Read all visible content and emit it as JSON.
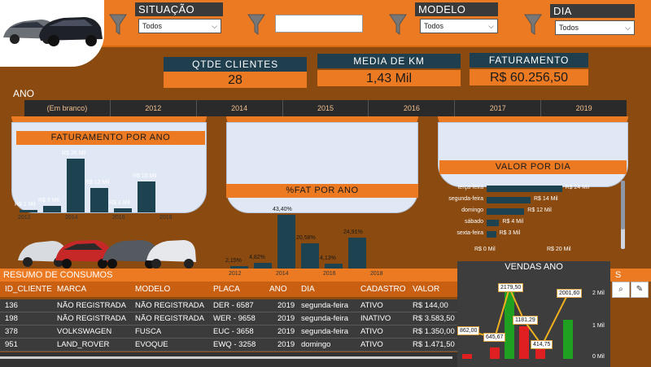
{
  "filters": {
    "situacao": {
      "label": "SITUAÇÃO",
      "value": "Todos"
    },
    "modelo": {
      "label": "MODELO",
      "value": "Todos"
    },
    "dia": {
      "label": "DIA",
      "value": "Todos"
    }
  },
  "kpis": {
    "qtde_clientes": {
      "label": "QTDE CLIENTES",
      "value": "28"
    },
    "media_km": {
      "label": "MEDIA DE KM",
      "value": "1,43 Mil"
    },
    "faturamento": {
      "label": "FATURAMENTO",
      "value": "R$ 60.256,50"
    }
  },
  "ano_slicer": {
    "label": "ANO",
    "options": [
      "(Em branco)",
      "2012",
      "2014",
      "2015",
      "2016",
      "2017",
      "2019"
    ]
  },
  "chart_data": [
    {
      "type": "bar",
      "title": "FATURAMENTO POR ANO",
      "x_ticks": [
        "2012",
        "2014",
        "2016",
        "2018"
      ],
      "bars": [
        {
          "label": "R$ 1 Mil",
          "value": 1
        },
        {
          "label": "R$ 3 Mil",
          "value": 3
        },
        {
          "label": "R$ 26 Mil",
          "value": 26
        },
        {
          "label": "R$ 12 Mil",
          "value": 12
        },
        {
          "label": "R$ 2 Mil",
          "value": 2
        },
        {
          "label": "R$ 15 Mil",
          "value": 15
        }
      ]
    },
    {
      "type": "bar",
      "title": "%FAT POR ANO",
      "x_ticks": [
        "2012",
        "2014",
        "2016",
        "2018"
      ],
      "bars": [
        {
          "label": "2,15%",
          "value": 2.15
        },
        {
          "label": "4,82%",
          "value": 4.82
        },
        {
          "label": "43,40%",
          "value": 43.4
        },
        {
          "label": "20,58%",
          "value": 20.58
        },
        {
          "label": "4,13%",
          "value": 4.13
        },
        {
          "label": "24,91%",
          "value": 24.91
        }
      ]
    },
    {
      "type": "bar",
      "title": "VALOR POR DIA",
      "categories": [
        "terça-feira",
        "segunda-feira",
        "domingo",
        "sábado",
        "sexta-feira"
      ],
      "values": [
        24,
        14,
        12,
        4,
        3
      ],
      "value_labels": [
        "R$ 24 Mil",
        "R$ 14 Mil",
        "R$ 12 Mil",
        "R$ 4 Mil",
        "R$ 3 Mil"
      ],
      "x_ticks": [
        "R$ 0 Mil",
        "R$ 20 Mil"
      ],
      "xlim": [
        0,
        28
      ]
    },
    {
      "type": "bar",
      "title": "VENDAS ANO",
      "style": "waterfall",
      "labels": [
        "862,00",
        "645,67",
        "2179,50",
        "1181,29",
        "414,75",
        "2001,60"
      ],
      "y_ticks": [
        "2 Mil",
        "1 Mil",
        "0 Mil"
      ],
      "ylim": [
        0,
        2000
      ]
    }
  ],
  "table": {
    "title": "RESUMO DE CONSUMOS",
    "columns": [
      "ID_CLIENTE",
      "MARCA",
      "MODELO",
      "PLACA",
      "ANO",
      "DIA",
      "CADASTRO",
      "VALOR"
    ],
    "rows": [
      [
        "136",
        "NÃO REGISTRADA",
        "NÃO REGISTRADA",
        "DER - 6587",
        "2019",
        "segunda-feira",
        "ATIVO",
        "R$ 144,00"
      ],
      [
        "198",
        "NÃO REGISTRADA",
        "NÃO REGISTRADA",
        "WER - 9658",
        "2019",
        "segunda-feira",
        "INATIVO",
        "R$ 3.583,50"
      ],
      [
        "378",
        "VOLKSWAGEN",
        "FUSCA",
        "EUC - 3658",
        "2019",
        "segunda-feira",
        "ATIVO",
        "R$ 1.350,00"
      ],
      [
        "951",
        "LAND_ROVER",
        "EVOQUE",
        "EWQ - 3258",
        "2019",
        "domingo",
        "ATIVO",
        "R$ 1.471,50"
      ]
    ]
  },
  "side": {
    "text": "S"
  },
  "colors": {
    "orange": "#ec7a22",
    "dark_teal": "#1d4350",
    "brown_bg": "#8a4a10",
    "panel": "#dfe8f4"
  }
}
